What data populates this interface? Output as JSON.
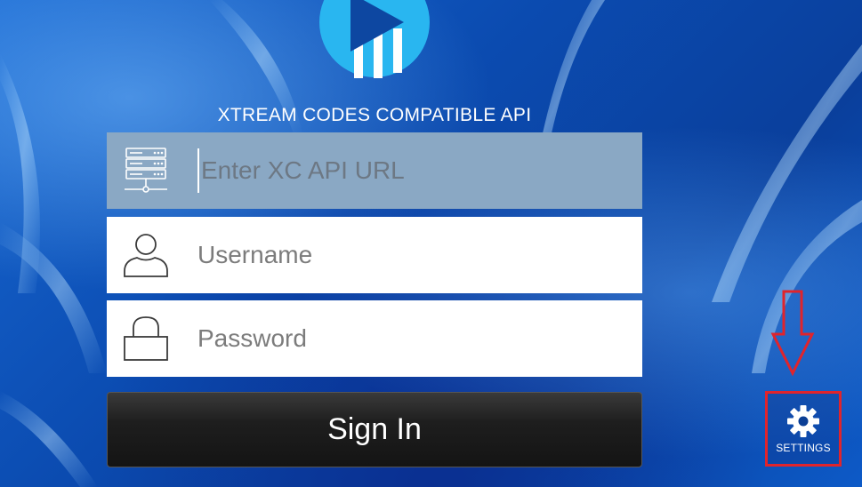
{
  "app": {
    "subtitle": "XTREAM CODES COMPATIBLE API"
  },
  "form": {
    "url_placeholder": "Enter XC API URL",
    "username_placeholder": "Username",
    "password_placeholder": "Password",
    "signin_label": "Sign In"
  },
  "settings": {
    "label": "SETTINGS"
  },
  "icons": {
    "logo": "play-logo-icon",
    "url": "server-icon",
    "username": "user-icon",
    "password": "lock-icon",
    "settings": "gear-icon",
    "annotation": "arrow-down-icon"
  },
  "colors": {
    "background": "#0a4fb0",
    "logo": "#29b6f0",
    "logo_play": "#0d47a1",
    "url_field": "#8aa8c4",
    "annotation": "#e0242c",
    "signin": "#1e1e1e"
  }
}
